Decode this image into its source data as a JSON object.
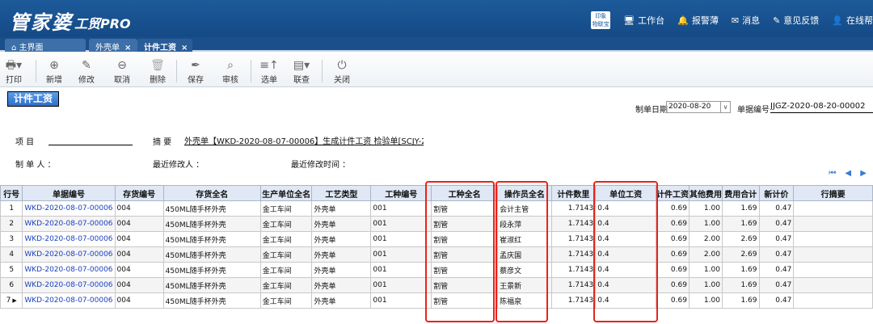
{
  "app": {
    "logo": "管家婆",
    "logo_sub": "工贸PRO"
  },
  "topnav": {
    "wechat_badge": "印象\n物联宝",
    "items": [
      "工作台",
      "报警薄",
      "消息",
      "意见反馈",
      "在线帮"
    ]
  },
  "tabs": [
    {
      "label": "主界面"
    },
    {
      "label": "外壳单",
      "close": "×"
    },
    {
      "label": "计件工资",
      "close": "×"
    }
  ],
  "toolbar": {
    "print": "打印",
    "add": "新增",
    "edit": "修改",
    "cancel": "取消",
    "delete": "删除",
    "save": "保存",
    "review": "审核",
    "select": "选单",
    "query": "联查",
    "close": "关闭"
  },
  "page": {
    "title": "计件工资"
  },
  "form": {
    "date_label": "制单日期",
    "date_value": "2020-08-20",
    "number_label": "单据编号",
    "number_value": "JJGZ-2020-08-20-00002",
    "project_label": "项    目",
    "project_value": "",
    "summary_label": "摘    要",
    "summary_value": "外壳单【WKD-2020-08-07-00006】生成计件工资 检验单[SCJY-2020-08-",
    "maker_label": "制 单 人 ：",
    "last_modifier_label": "最近修改人 ：",
    "last_modified_label": "最近修改时间 ："
  },
  "pager": {
    "icons": "⏮ ◀ ▶"
  },
  "table": {
    "headers": [
      "行号",
      "单据编号",
      "存货编号",
      "存货全名",
      "生产单位全名",
      "工艺类型",
      "工种编号",
      "工种全名",
      "操作员全名",
      "计件数里",
      "单位工资",
      "计件工资",
      "其他费用",
      "费用合计",
      "新计价",
      "行摘要"
    ],
    "rows": [
      [
        "1",
        "WKD-2020-08-07-00006",
        "004",
        "450ML随手杯外壳",
        "金工车间",
        "外壳单",
        "001",
        "割管",
        "会计主管",
        "1.7143",
        "0.4",
        "0.69",
        "1.00",
        "1.69",
        "0.47",
        ""
      ],
      [
        "2",
        "WKD-2020-08-07-00006",
        "004",
        "450ML随手杯外壳",
        "金工车间",
        "外壳单",
        "001",
        "割管",
        "段永萍",
        "1.7143",
        "0.4",
        "0.69",
        "1.00",
        "1.69",
        "0.47",
        ""
      ],
      [
        "3",
        "WKD-2020-08-07-00006",
        "004",
        "450ML随手杯外壳",
        "金工车间",
        "外壳单",
        "001",
        "割管",
        "崔淑红",
        "1.7143",
        "0.4",
        "0.69",
        "2.00",
        "2.69",
        "0.47",
        ""
      ],
      [
        "4",
        "WKD-2020-08-07-00006",
        "004",
        "450ML随手杯外壳",
        "金工车间",
        "外壳单",
        "001",
        "割管",
        "孟庆国",
        "1.7143",
        "0.4",
        "0.69",
        "2.00",
        "2.69",
        "0.47",
        ""
      ],
      [
        "5",
        "WKD-2020-08-07-00006",
        "004",
        "450ML随手杯外壳",
        "金工车间",
        "外壳单",
        "001",
        "割管",
        "蔡彦文",
        "1.7143",
        "0.4",
        "0.69",
        "1.00",
        "1.69",
        "0.47",
        ""
      ],
      [
        "6",
        "WKD-2020-08-07-00006",
        "004",
        "450ML随手杯外壳",
        "金工车间",
        "外壳单",
        "001",
        "割管",
        "王景新",
        "1.7143",
        "0.4",
        "0.69",
        "1.00",
        "1.69",
        "0.47",
        ""
      ],
      [
        "7",
        "WKD-2020-08-07-00006",
        "004",
        "450ML随手杯外壳",
        "金工车间",
        "外壳单",
        "001",
        "割管",
        "陈福泉",
        "1.7143",
        "0.4",
        "0.69",
        "1.00",
        "1.69",
        "0.47",
        ""
      ]
    ],
    "current_row_marker": "▶"
  },
  "colors": {
    "highlight": "#e8231b",
    "header_bg": "#1d5a9a",
    "link": "#1a3fbf"
  }
}
